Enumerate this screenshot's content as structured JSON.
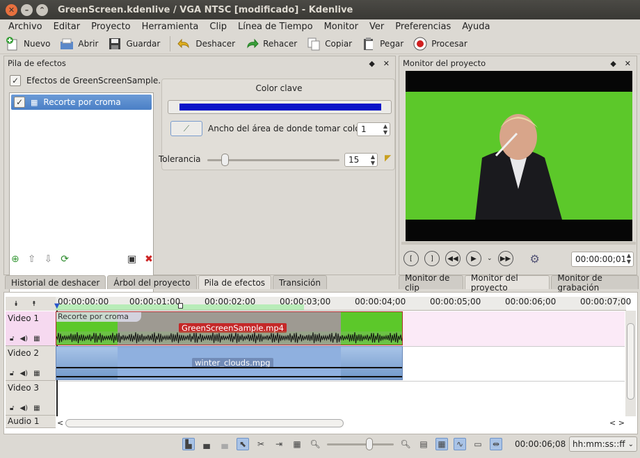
{
  "window": {
    "title": "GreenScreen.kdenlive / VGA NTSC [modificado] - Kdenlive"
  },
  "menu": [
    "Archivo",
    "Editar",
    "Proyecto",
    "Herramienta",
    "Clip",
    "Línea de Tiempo",
    "Monitor",
    "Ver",
    "Preferencias",
    "Ayuda"
  ],
  "toolbar": {
    "new": "Nuevo",
    "open": "Abrir",
    "save": "Guardar",
    "undo": "Deshacer",
    "redo": "Rehacer",
    "copy": "Copiar",
    "paste": "Pegar",
    "render": "Procesar"
  },
  "effects_panel": {
    "title": "Pila de efectos",
    "stack_label": "Efectos de GreenScreenSample...",
    "effect_item": "Recorte por croma",
    "key_color_label": "Color clave",
    "key_color": "#0a14c8",
    "area_label": "Ancho del área de donde tomar color:",
    "area_value": "1",
    "tolerance_label": "Tolerancia",
    "tolerance_value": "15"
  },
  "monitor_panel": {
    "title": "Monitor del proyecto",
    "timecode": "00:00:00;01"
  },
  "left_tabs": [
    "Historial de deshacer",
    "Árbol del proyecto",
    "Pila de efectos",
    "Transición"
  ],
  "right_tabs": [
    "Monitor de clip",
    "Monitor del proyecto",
    "Monitor de grabación"
  ],
  "timeline": {
    "ruler": [
      "00:00:00;00",
      "00:00:01;00",
      "00:00:02;00",
      "00:00:03;00",
      "00:00:04;00",
      "00:00:05;00",
      "00:00:06;00",
      "00:00:07;00"
    ],
    "tracks": [
      "Video 1",
      "Video 2",
      "Video 3",
      "Audio 1"
    ],
    "clip1_effect": "Recorte por croma",
    "clip1_name": "GreenScreenSample.mp4",
    "clip2_name": "winter_clouds.mpg"
  },
  "status": {
    "timecode": "00:00:06;08",
    "format": "hh:mm:ss::ff"
  }
}
